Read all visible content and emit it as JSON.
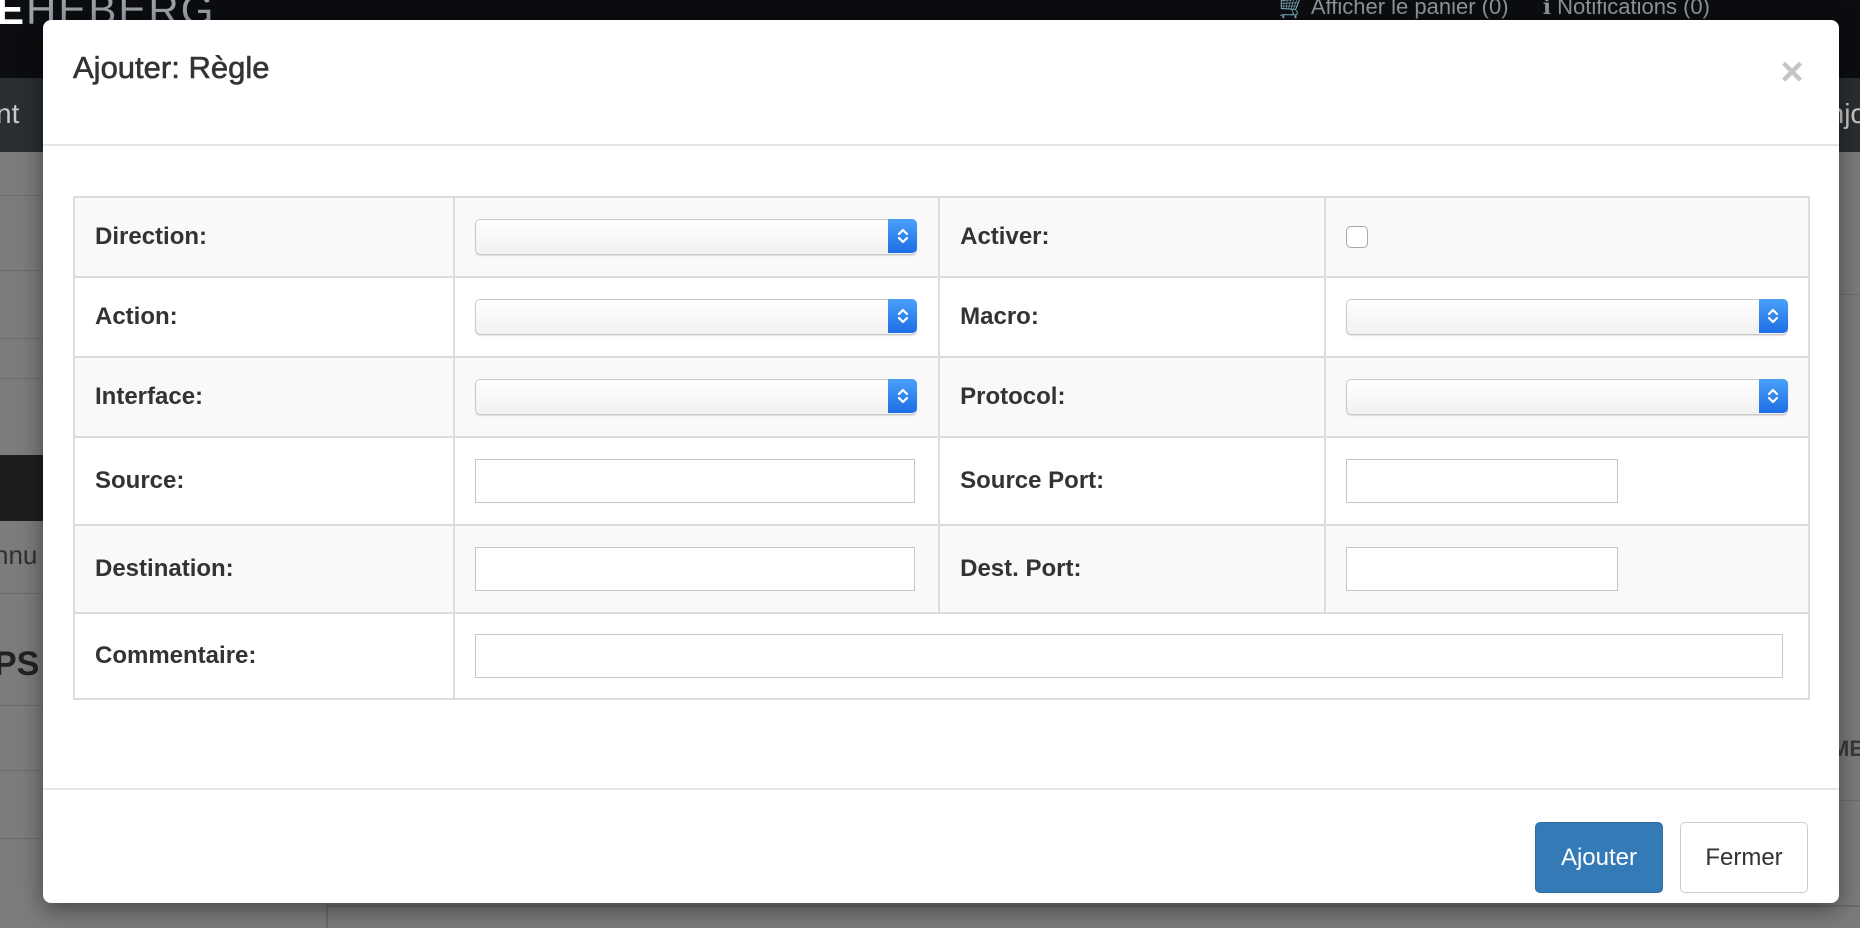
{
  "background": {
    "brand_bold": "E",
    "brand_light": "HEBERG",
    "cart_link": "🛒 Afficher le panier (0)",
    "notifications_link": "ℹ Notifications (0)",
    "nav_left": "nt",
    "nav_right": "njo",
    "side_text_1": "nnu",
    "side_text_2": "PS",
    "right_text": "ME"
  },
  "modal": {
    "title": "Ajouter: Règle",
    "close_glyph": "×",
    "fields": {
      "direction": {
        "label": "Direction:",
        "value": ""
      },
      "activer": {
        "label": "Activer:",
        "checked": false
      },
      "action": {
        "label": "Action:",
        "value": ""
      },
      "macro": {
        "label": "Macro:",
        "value": ""
      },
      "interface": {
        "label": "Interface:",
        "value": ""
      },
      "protocol": {
        "label": "Protocol:",
        "value": ""
      },
      "source": {
        "label": "Source:",
        "value": ""
      },
      "source_port": {
        "label": "Source Port:",
        "value": ""
      },
      "destination": {
        "label": "Destination:",
        "value": ""
      },
      "dest_port": {
        "label": "Dest. Port:",
        "value": ""
      },
      "commentaire": {
        "label": "Commentaire:",
        "value": ""
      }
    },
    "buttons": {
      "submit": "Ajouter",
      "close": "Fermer"
    }
  },
  "colors": {
    "primary": "#337ab7",
    "select_arrow": "#1d6ee6"
  }
}
